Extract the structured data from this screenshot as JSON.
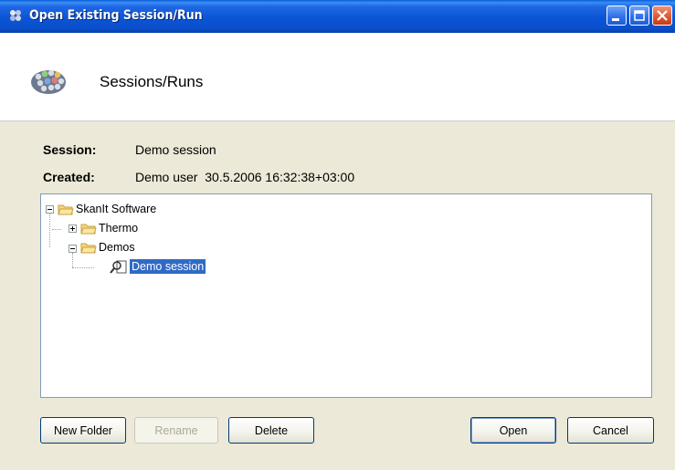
{
  "window": {
    "title": "Open Existing Session/Run"
  },
  "header": {
    "title": "Sessions/Runs"
  },
  "info": {
    "session_label": "Session:",
    "session_value": "Demo session",
    "created_label": "Created:",
    "created_value": "Demo user  30.5.2006 16:32:38+03:00"
  },
  "tree": {
    "root": "SkanIt Software",
    "children": [
      "Thermo",
      "Demos"
    ],
    "selected": "Demo session"
  },
  "buttons": {
    "new_folder": "New Folder",
    "rename": "Rename",
    "delete": "Delete",
    "open": "Open",
    "cancel": "Cancel"
  },
  "colors": {
    "titlebar": "#0a55d6",
    "selection": "#316ac5",
    "dialog_bg": "#ece9d8"
  }
}
